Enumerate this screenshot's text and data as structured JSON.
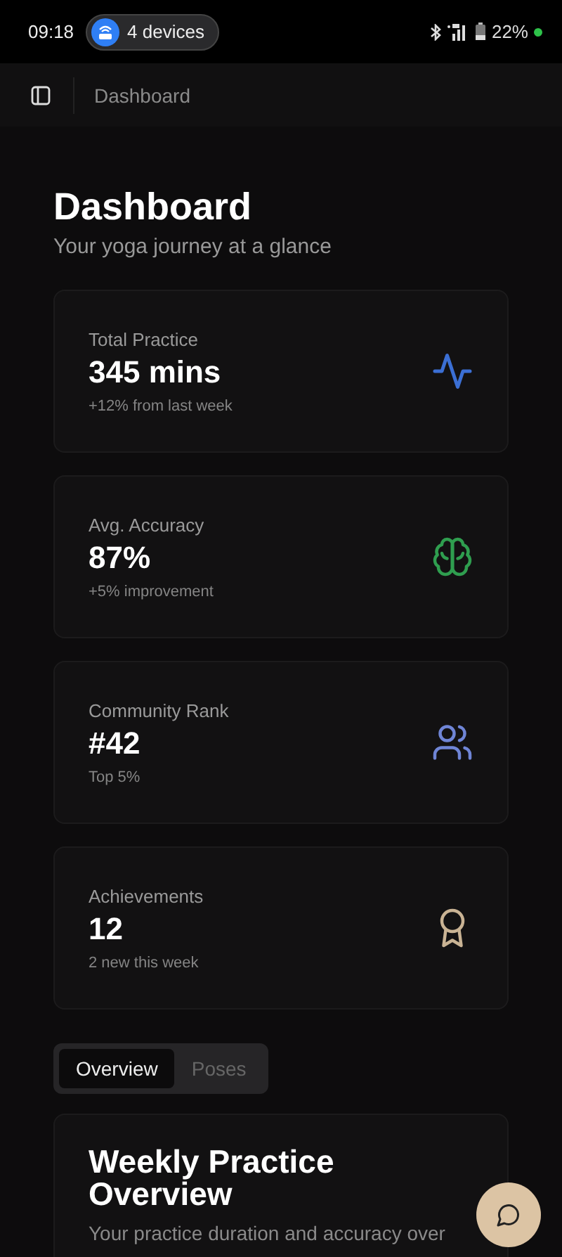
{
  "status_bar": {
    "time": "09:18",
    "devices": "4 devices",
    "battery": "22%"
  },
  "header": {
    "breadcrumb": "Dashboard"
  },
  "page": {
    "title": "Dashboard",
    "subtitle": "Your yoga journey at a glance"
  },
  "stats": [
    {
      "label": "Total Practice",
      "value": "345 mins",
      "note": "+12% from last week",
      "kind": "activity",
      "color": "#3b6fd4"
    },
    {
      "label": "Avg. Accuracy",
      "value": "87%",
      "note": "+5% improvement",
      "kind": "brain",
      "color": "#2f9e4f"
    },
    {
      "label": "Community Rank",
      "value": "#42",
      "note": "Top 5%",
      "kind": "users",
      "color": "#6f85d6"
    },
    {
      "label": "Achievements",
      "value": "12",
      "note": "2 new this week",
      "kind": "award",
      "color": "#c9b394"
    }
  ],
  "tabs": [
    {
      "label": "Overview",
      "selected": true
    },
    {
      "label": "Poses",
      "selected": false
    }
  ],
  "overview_card": {
    "title": "Weekly Practice Overview",
    "description": "Your practice duration and accuracy over"
  }
}
